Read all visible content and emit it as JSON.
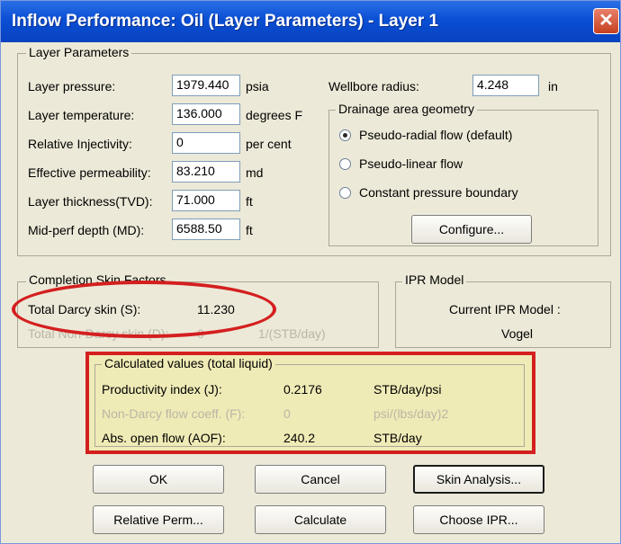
{
  "window": {
    "title": "Inflow Performance: Oil (Layer Parameters) - Layer 1",
    "close_glyph": "✕"
  },
  "layer_parameters": {
    "group_label": "Layer Parameters",
    "rows": [
      {
        "label": "Layer pressure:",
        "value": "1979.440",
        "unit": "psia"
      },
      {
        "label": "Layer temperature:",
        "value": "136.000",
        "unit": "degrees F"
      },
      {
        "label": "Relative Injectivity:",
        "value": "0",
        "unit": "per cent"
      },
      {
        "label": "Effective permeability:",
        "value": "83.210",
        "unit": "md"
      },
      {
        "label": "Layer thickness(TVD):",
        "value": "71.000",
        "unit": "ft"
      },
      {
        "label": "Mid-perf depth (MD):",
        "value": "6588.50",
        "unit": "ft"
      }
    ],
    "wellbore": {
      "label": "Wellbore radius:",
      "value": "4.248",
      "unit": "in"
    },
    "drainage": {
      "group_label": "Drainage area geometry",
      "options": [
        "Pseudo-radial flow (default)",
        "Pseudo-linear flow",
        "Constant pressure boundary"
      ],
      "selected": "Pseudo-radial flow (default)",
      "configure_label": "Configure..."
    }
  },
  "skin": {
    "group_label": "Completion Skin Factors",
    "total_label": "Total Darcy skin (S):",
    "total_value": "11.230",
    "nondarcy_label": "Total Non-Darcy skin (D):",
    "nondarcy_value": "0",
    "nondarcy_unit": "1/(STB/day)"
  },
  "ipr": {
    "group_label": "IPR Model",
    "current_label": "Current IPR Model :",
    "current_value": "Vogel"
  },
  "calculated": {
    "group_label": "Calculated values (total liquid)",
    "rows": [
      {
        "label": "Productivity index (J):",
        "value": "0.2176",
        "unit": "STB/day/psi"
      },
      {
        "label": "Non-Darcy flow coeff. (F):",
        "value": "0",
        "unit": "psi/(lbs/day)2"
      },
      {
        "label": "Abs. open flow (AOF):",
        "value": "240.2",
        "unit": "STB/day"
      }
    ]
  },
  "buttons": {
    "ok": "OK",
    "cancel": "Cancel",
    "skin_analysis": "Skin Analysis...",
    "relative_perm": "Relative Perm...",
    "calculate": "Calculate",
    "choose_ipr": "Choose IPR..."
  },
  "colors": {
    "titlebar": "#0a4fd4",
    "annotation_red": "#d41f1f",
    "highlight_fill": "#efebb6",
    "dialog_bg": "#ece9d8"
  }
}
